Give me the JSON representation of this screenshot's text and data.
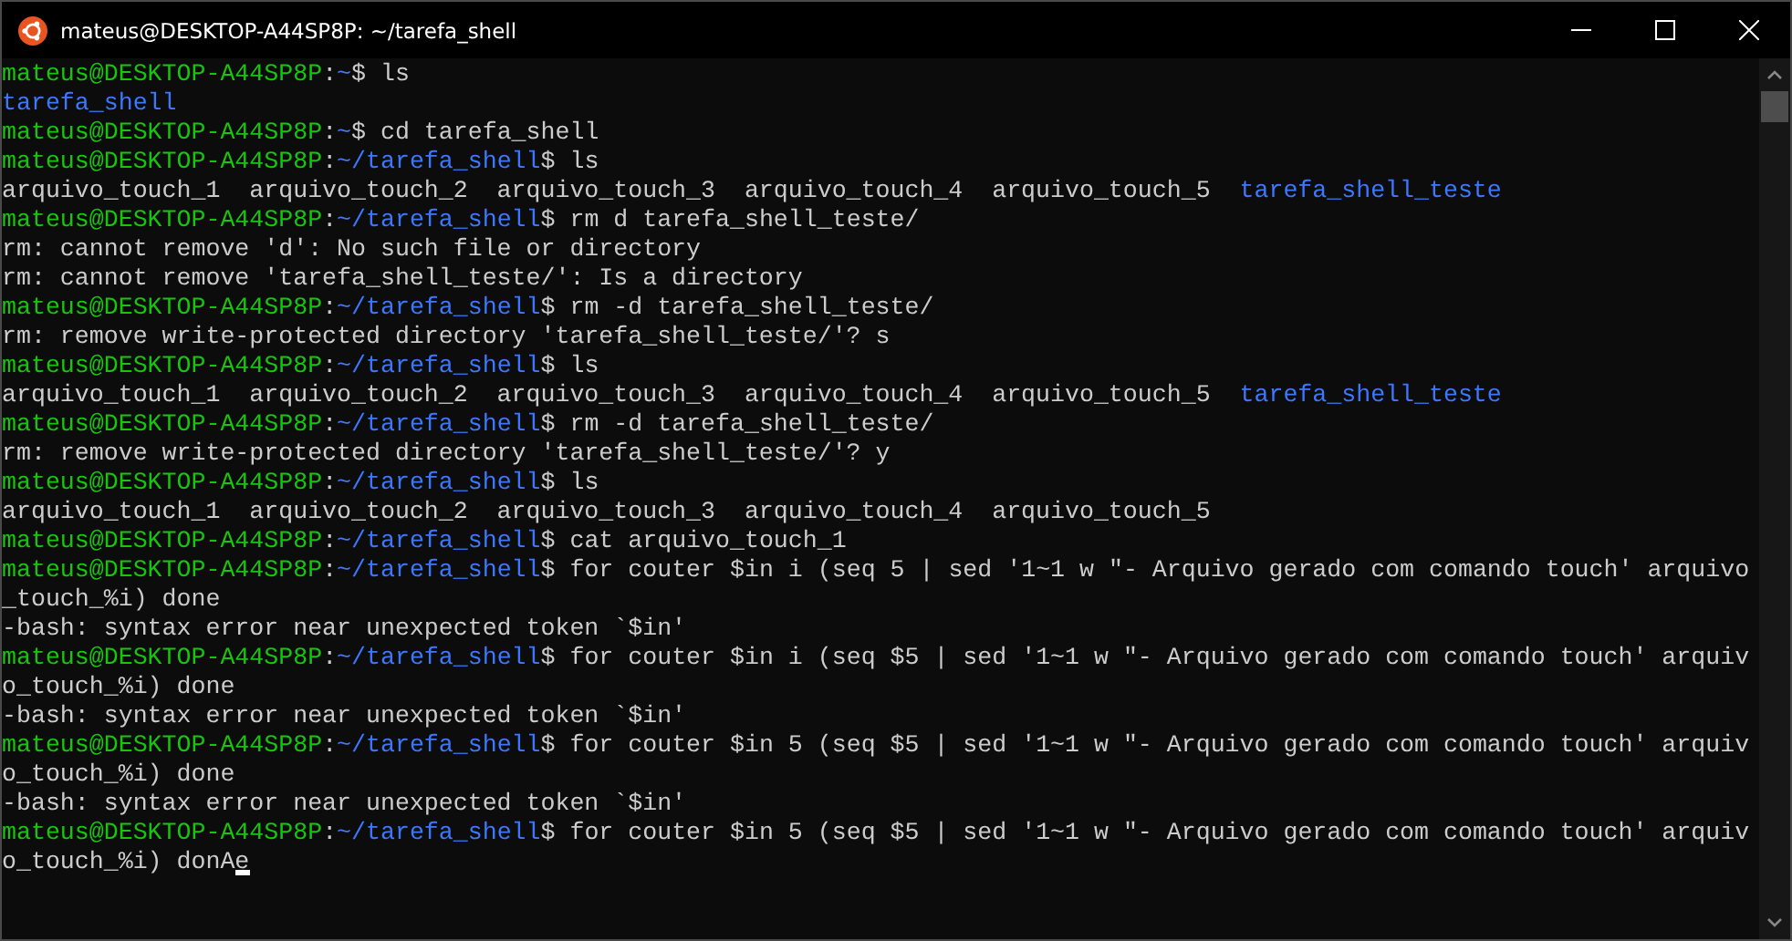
{
  "window": {
    "title": "mateus@DESKTOP-A44SP8P: ~/tarefa_shell"
  },
  "lines": [
    [
      {
        "kind": "user",
        "text": "mateus@DESKTOP-A44SP8P"
      },
      {
        "kind": "plain",
        "text": ":"
      },
      {
        "kind": "path",
        "text": "~"
      },
      {
        "kind": "plain",
        "text": "$ ls"
      }
    ],
    [
      {
        "kind": "dir",
        "text": "tarefa_shell"
      }
    ],
    [
      {
        "kind": "user",
        "text": "mateus@DESKTOP-A44SP8P"
      },
      {
        "kind": "plain",
        "text": ":"
      },
      {
        "kind": "path",
        "text": "~"
      },
      {
        "kind": "plain",
        "text": "$ cd tarefa_shell"
      }
    ],
    [
      {
        "kind": "user",
        "text": "mateus@DESKTOP-A44SP8P"
      },
      {
        "kind": "plain",
        "text": ":"
      },
      {
        "kind": "path",
        "text": "~/tarefa_shell"
      },
      {
        "kind": "plain",
        "text": "$ ls"
      }
    ],
    [
      {
        "kind": "plain",
        "text": "arquivo_touch_1  arquivo_touch_2  arquivo_touch_3  arquivo_touch_4  arquivo_touch_5  "
      },
      {
        "kind": "dir",
        "text": "tarefa_shell_teste"
      }
    ],
    [
      {
        "kind": "user",
        "text": "mateus@DESKTOP-A44SP8P"
      },
      {
        "kind": "plain",
        "text": ":"
      },
      {
        "kind": "path",
        "text": "~/tarefa_shell"
      },
      {
        "kind": "plain",
        "text": "$ rm d tarefa_shell_teste/"
      }
    ],
    [
      {
        "kind": "plain",
        "text": "rm: cannot remove 'd': No such file or directory"
      }
    ],
    [
      {
        "kind": "plain",
        "text": "rm: cannot remove 'tarefa_shell_teste/': Is a directory"
      }
    ],
    [
      {
        "kind": "user",
        "text": "mateus@DESKTOP-A44SP8P"
      },
      {
        "kind": "plain",
        "text": ":"
      },
      {
        "kind": "path",
        "text": "~/tarefa_shell"
      },
      {
        "kind": "plain",
        "text": "$ rm -d tarefa_shell_teste/"
      }
    ],
    [
      {
        "kind": "plain",
        "text": "rm: remove write-protected directory 'tarefa_shell_teste/'? s"
      }
    ],
    [
      {
        "kind": "user",
        "text": "mateus@DESKTOP-A44SP8P"
      },
      {
        "kind": "plain",
        "text": ":"
      },
      {
        "kind": "path",
        "text": "~/tarefa_shell"
      },
      {
        "kind": "plain",
        "text": "$ ls"
      }
    ],
    [
      {
        "kind": "plain",
        "text": "arquivo_touch_1  arquivo_touch_2  arquivo_touch_3  arquivo_touch_4  arquivo_touch_5  "
      },
      {
        "kind": "dir",
        "text": "tarefa_shell_teste"
      }
    ],
    [
      {
        "kind": "user",
        "text": "mateus@DESKTOP-A44SP8P"
      },
      {
        "kind": "plain",
        "text": ":"
      },
      {
        "kind": "path",
        "text": "~/tarefa_shell"
      },
      {
        "kind": "plain",
        "text": "$ rm -d tarefa_shell_teste/"
      }
    ],
    [
      {
        "kind": "plain",
        "text": "rm: remove write-protected directory 'tarefa_shell_teste/'? y"
      }
    ],
    [
      {
        "kind": "user",
        "text": "mateus@DESKTOP-A44SP8P"
      },
      {
        "kind": "plain",
        "text": ":"
      },
      {
        "kind": "path",
        "text": "~/tarefa_shell"
      },
      {
        "kind": "plain",
        "text": "$ ls"
      }
    ],
    [
      {
        "kind": "plain",
        "text": "arquivo_touch_1  arquivo_touch_2  arquivo_touch_3  arquivo_touch_4  arquivo_touch_5"
      }
    ],
    [
      {
        "kind": "user",
        "text": "mateus@DESKTOP-A44SP8P"
      },
      {
        "kind": "plain",
        "text": ":"
      },
      {
        "kind": "path",
        "text": "~/tarefa_shell"
      },
      {
        "kind": "plain",
        "text": "$ cat arquivo_touch_1"
      }
    ],
    [
      {
        "kind": "user",
        "text": "mateus@DESKTOP-A44SP8P"
      },
      {
        "kind": "plain",
        "text": ":"
      },
      {
        "kind": "path",
        "text": "~/tarefa_shell"
      },
      {
        "kind": "plain",
        "text": "$ for couter $in i (seq 5 | sed '1~1 w \"- Arquivo gerado com comando touch' arquivo"
      }
    ],
    [
      {
        "kind": "plain",
        "text": "_touch_%i) done"
      }
    ],
    [
      {
        "kind": "plain",
        "text": "-bash: syntax error near unexpected token `$in'"
      }
    ],
    [
      {
        "kind": "user",
        "text": "mateus@DESKTOP-A44SP8P"
      },
      {
        "kind": "plain",
        "text": ":"
      },
      {
        "kind": "path",
        "text": "~/tarefa_shell"
      },
      {
        "kind": "plain",
        "text": "$ for couter $in i (seq $5 | sed '1~1 w \"- Arquivo gerado com comando touch' arquiv"
      }
    ],
    [
      {
        "kind": "plain",
        "text": "o_touch_%i) done"
      }
    ],
    [
      {
        "kind": "plain",
        "text": "-bash: syntax error near unexpected token `$in'"
      }
    ],
    [
      {
        "kind": "user",
        "text": "mateus@DESKTOP-A44SP8P"
      },
      {
        "kind": "plain",
        "text": ":"
      },
      {
        "kind": "path",
        "text": "~/tarefa_shell"
      },
      {
        "kind": "plain",
        "text": "$ for couter $in 5 (seq $5 | sed '1~1 w \"- Arquivo gerado com comando touch' arquiv"
      }
    ],
    [
      {
        "kind": "plain",
        "text": "o_touch_%i) done"
      }
    ],
    [
      {
        "kind": "plain",
        "text": "-bash: syntax error near unexpected token `$in'"
      }
    ],
    [
      {
        "kind": "user",
        "text": "mateus@DESKTOP-A44SP8P"
      },
      {
        "kind": "plain",
        "text": ":"
      },
      {
        "kind": "path",
        "text": "~/tarefa_shell"
      },
      {
        "kind": "plain",
        "text": "$ for couter $in 5 (seq $5 | sed '1~1 w \"- Arquivo gerado com comando touch' arquiv"
      }
    ],
    [
      {
        "kind": "plain",
        "text": "o_touch_%i) donA"
      },
      {
        "kind": "cursor",
        "text": "e"
      }
    ]
  ]
}
